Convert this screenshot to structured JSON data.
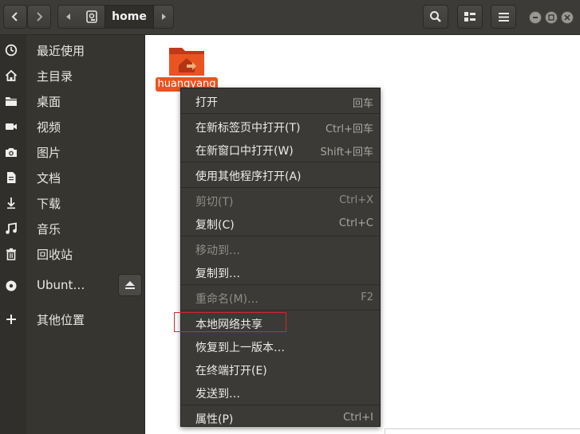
{
  "header": {
    "path_home_label": "home",
    "colors": {
      "bar": "#3c3b37",
      "button": "#4a4945"
    }
  },
  "sidebar": {
    "items": [
      {
        "label": "最近使用",
        "icon": "clock-icon"
      },
      {
        "label": "主目录",
        "icon": "home-icon"
      },
      {
        "label": "桌面",
        "icon": "folder-icon"
      },
      {
        "label": "视频",
        "icon": "video-icon"
      },
      {
        "label": "图片",
        "icon": "camera-icon"
      },
      {
        "label": "文档",
        "icon": "document-icon"
      },
      {
        "label": "下载",
        "icon": "download-icon"
      },
      {
        "label": "音乐",
        "icon": "music-icon"
      },
      {
        "label": "回收站",
        "icon": "trash-icon"
      },
      {
        "label": "Ubunt…",
        "icon": "disc-icon"
      },
      {
        "label": "其他位置",
        "icon": "plus-icon"
      }
    ]
  },
  "content": {
    "folder_label": "huangyang",
    "accent": "#e95420"
  },
  "context_menu": {
    "items": [
      {
        "label": "打开",
        "accel": "回车",
        "enabled": true
      },
      {
        "label": "在新标签页中打开(T)",
        "accel": "Ctrl+回车",
        "enabled": true
      },
      {
        "label": "在新窗口中打开(W)",
        "accel": "Shift+回车",
        "enabled": true
      },
      {
        "label": "使用其他程序打开(A)",
        "accel": "",
        "enabled": true
      },
      {
        "label": "剪切(T)",
        "accel": "Ctrl+X",
        "enabled": false
      },
      {
        "label": "复制(C)",
        "accel": "Ctrl+C",
        "enabled": true
      },
      {
        "label": "移动到…",
        "accel": "",
        "enabled": false
      },
      {
        "label": "复制到…",
        "accel": "",
        "enabled": true
      },
      {
        "label": "重命名(M)…",
        "accel": "F2",
        "enabled": false
      },
      {
        "label": "本地网络共享",
        "accel": "",
        "enabled": true
      },
      {
        "label": "恢复到上一版本…",
        "accel": "",
        "enabled": true
      },
      {
        "label": "在终端打开(E)",
        "accel": "",
        "enabled": true
      },
      {
        "label": "发送到…",
        "accel": "",
        "enabled": true
      },
      {
        "label": "属性(P)",
        "accel": "Ctrl+I",
        "enabled": true
      }
    ],
    "highlight_color": "#d6262b"
  }
}
